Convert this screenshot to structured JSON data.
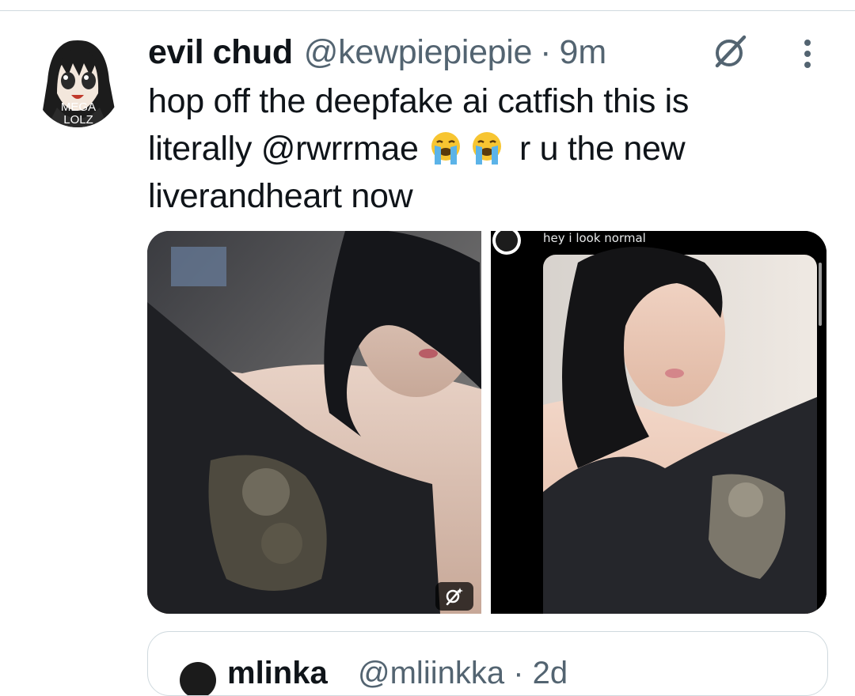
{
  "tweet": {
    "display_name": "evil chud",
    "handle": "@kewpiepiepie",
    "separator": "·",
    "time": "9m",
    "text_line1": "hop off the deepfake ai catfish this is",
    "text_line2_start": "literally @rwrrmae",
    "text_line2_end": "r u the new",
    "text_line3": "liverandheart now",
    "emoji": "loudly-crying-face",
    "avatar_text_top": "MEGA",
    "avatar_text_bottom": "LOLZ"
  },
  "media": {
    "right_photo_caption": "hey i look normal"
  },
  "quoted": {
    "name": "mlinka",
    "handle": "@mliinkka · 2d"
  },
  "icons": {
    "grok": "grok-slash-circle-icon",
    "more": "more-vertical-icon",
    "image_grok": "grok-edit-icon"
  },
  "colors": {
    "text": "#0f1419",
    "secondary": "#536471",
    "border": "#cfd9de"
  }
}
